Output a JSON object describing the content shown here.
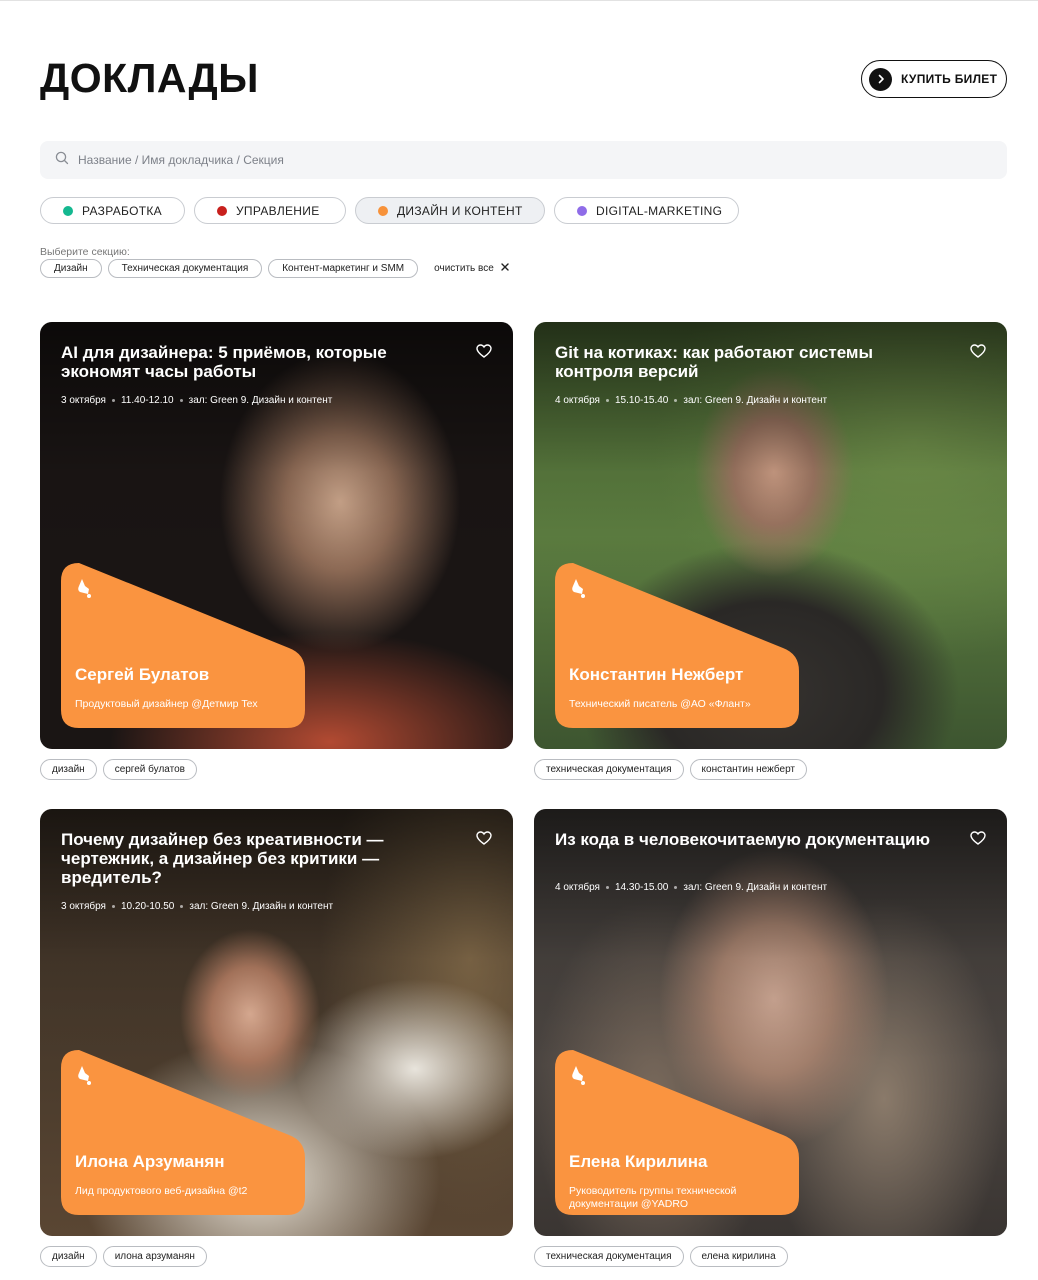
{
  "header": {
    "title": "ДОКЛАДЫ",
    "buy_label": "КУПИТЬ БИЛЕТ"
  },
  "search": {
    "placeholder": "Название / Имя докладчика / Секция"
  },
  "categories": [
    {
      "label": "РАЗРАБОТКА",
      "color": "#14b890",
      "active": false
    },
    {
      "label": "УПРАВЛЕНИЕ",
      "color": "#c8201d",
      "active": false
    },
    {
      "label": "ДИЗАЙН И КОНТЕНТ",
      "color": "#f7923a",
      "active": true
    },
    {
      "label": "DIGITAL-MARKETING",
      "color": "#8f6ce8",
      "active": false
    }
  ],
  "filters": {
    "section_label": "Выберите секцию:",
    "chips": [
      "Дизайн",
      "Техническая документация",
      "Контент-маркетинг и SMM"
    ],
    "clear_label": "очистить все"
  },
  "cards": [
    {
      "title": "AI для дизайнера: 5 приёмов, которые экономят часы работы",
      "date": "3 октября",
      "time": "11.40-12.10",
      "hall": "зал: Green 9. Дизайн и контент",
      "speaker": "Сергей Булатов",
      "role": "Продуктовый дизайнер @Детмир Tex",
      "tags": [
        "дизайн",
        "сергей булатов"
      ]
    },
    {
      "title": "Git на котиках: как работают системы контроля версий",
      "date": "4 октября",
      "time": "15.10-15.40",
      "hall": "зал: Green 9. Дизайн и контент",
      "speaker": "Константин Нежберт",
      "role": "Технический писатель @АО «Флант»",
      "tags": [
        "техническая документация",
        "константин нежберт"
      ]
    },
    {
      "title": "Почему дизайнер без креативности — чертежник, а дизайнер без критики — вредитель?",
      "date": "3 октября",
      "time": "10.20-10.50",
      "hall": "зал: Green 9. Дизайн и контент",
      "speaker": "Илона Арзуманян",
      "role": "Лид продуктового веб-дизайна @t2",
      "tags": [
        "дизайн",
        "илона арзуманян"
      ]
    },
    {
      "title": "Из кода в человекочитаемую документацию",
      "date": "4 октября",
      "time": "14.30-15.00",
      "hall": "зал: Green 9. Дизайн и контент",
      "speaker": "Елена Кирилина",
      "role": "Руководитель группы технической документации @YADRO",
      "tags": [
        "техническая документация",
        "елена кирилина"
      ]
    }
  ],
  "colors": {
    "accent": "#fa9440",
    "text": "#111111"
  }
}
